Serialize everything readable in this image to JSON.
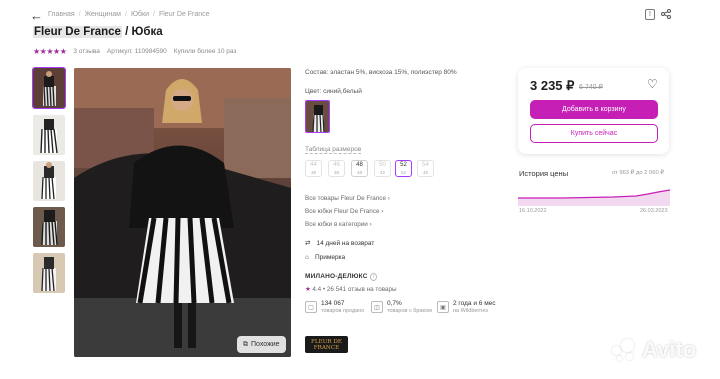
{
  "breadcrumb": [
    "Главная",
    "Женщинам",
    "Юбки",
    "Fleur De France"
  ],
  "title": {
    "brand": "Fleur De France",
    "rest": " / Юбка"
  },
  "meta": {
    "reviews": "3 отзыва",
    "article": "Артикул: 110984590",
    "bought": "Купили более 10 раз"
  },
  "similar_label": "Похожие",
  "composition": "Состав: эластан 5%, вискоза 15%, полиэстер 80%",
  "color_label": "Цвет: синий,белый",
  "size_table_link": "Таблица размеров",
  "sizes": [
    {
      "top": "44",
      "sub": "36",
      "state": "na"
    },
    {
      "top": "46",
      "sub": "38",
      "state": "na"
    },
    {
      "top": "48",
      "sub": "48",
      "state": "avail"
    },
    {
      "top": "50",
      "sub": "42",
      "state": "na"
    },
    {
      "top": "52",
      "sub": "52",
      "state": "sel"
    },
    {
      "top": "54",
      "sub": "46",
      "state": "na"
    }
  ],
  "links": [
    "Все товары Fleur De France",
    "Все юбки Fleur De France",
    "Все юбки в категории"
  ],
  "features": [
    "14 дней на возврат",
    "Примерка"
  ],
  "seller": "МИЛАНО-ДЕЛЮКС",
  "seller_rating": "4.4",
  "seller_reviews": "26 541 отзыв на товары",
  "stats": [
    {
      "value": "134 067",
      "label": "товаров продано"
    },
    {
      "value": "0,7%",
      "label": "товаров с браком"
    },
    {
      "value": "2 года и 6 мес",
      "label": "на Wildberries"
    }
  ],
  "brand_logo": [
    "FLEUR DE",
    "FRANCE"
  ],
  "price": "3 235 ₽",
  "old_price": "6 740 ₽",
  "add_to_cart": "Добавить в корзину",
  "buy_now": "Купить сейчас",
  "price_history": {
    "title": "История цены",
    "range": "от 963 ₽ до 2 060 ₽",
    "date_start": "16.10.2022",
    "date_end": "26.03.2023"
  },
  "watermark": "Avito",
  "colors": {
    "accent": "#c61fb6",
    "selection": "#a73afd",
    "stars": "#a12c9c"
  }
}
